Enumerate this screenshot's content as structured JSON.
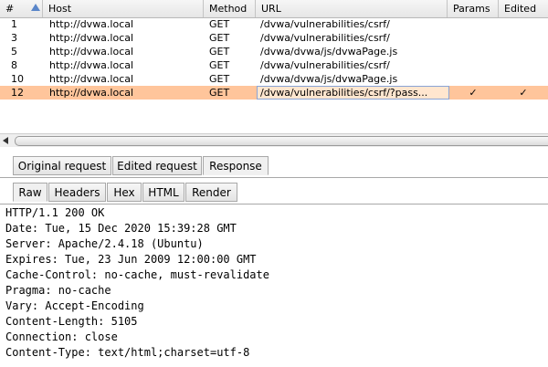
{
  "table": {
    "columns": [
      "#",
      "Host",
      "Method",
      "URL",
      "Params",
      "Edited"
    ],
    "rows": [
      {
        "num": "1",
        "host": "http://dvwa.local",
        "method": "GET",
        "url": "/dvwa/vulnerabilities/csrf/",
        "params": "",
        "edited": ""
      },
      {
        "num": "3",
        "host": "http://dvwa.local",
        "method": "GET",
        "url": "/dvwa/vulnerabilities/csrf/",
        "params": "",
        "edited": ""
      },
      {
        "num": "5",
        "host": "http://dvwa.local",
        "method": "GET",
        "url": "/dvwa/dvwa/js/dvwaPage.js",
        "params": "",
        "edited": ""
      },
      {
        "num": "8",
        "host": "http://dvwa.local",
        "method": "GET",
        "url": "/dvwa/vulnerabilities/csrf/",
        "params": "",
        "edited": ""
      },
      {
        "num": "10",
        "host": "http://dvwa.local",
        "method": "GET",
        "url": "/dvwa/dvwa/js/dvwaPage.js",
        "params": "",
        "edited": ""
      },
      {
        "num": "12",
        "host": "http://dvwa.local",
        "method": "GET",
        "url": "/dvwa/vulnerabilities/csrf/?pass...",
        "params": "✓",
        "edited": "✓"
      }
    ]
  },
  "request_tabs": [
    "Original request",
    "Edited request",
    "Response"
  ],
  "view_tabs": [
    "Raw",
    "Headers",
    "Hex",
    "HTML",
    "Render"
  ],
  "response_lines": [
    "HTTP/1.1 200 OK",
    "Date: Tue, 15 Dec 2020 15:39:28 GMT",
    "Server: Apache/2.4.18 (Ubuntu)",
    "Expires: Tue, 23 Jun 2009 12:00:00 GMT",
    "Cache-Control: no-cache, must-revalidate",
    "Pragma: no-cache",
    "Vary: Accept-Encoding",
    "Content-Length: 5105",
    "Connection: close",
    "Content-Type: text/html;charset=utf-8"
  ],
  "colors": {
    "selected_row": "#ffc59b",
    "sort_arrow": "#5a86c9"
  },
  "icons": [
    "sort-ascending-icon",
    "scroll-left-arrow-icon"
  ]
}
